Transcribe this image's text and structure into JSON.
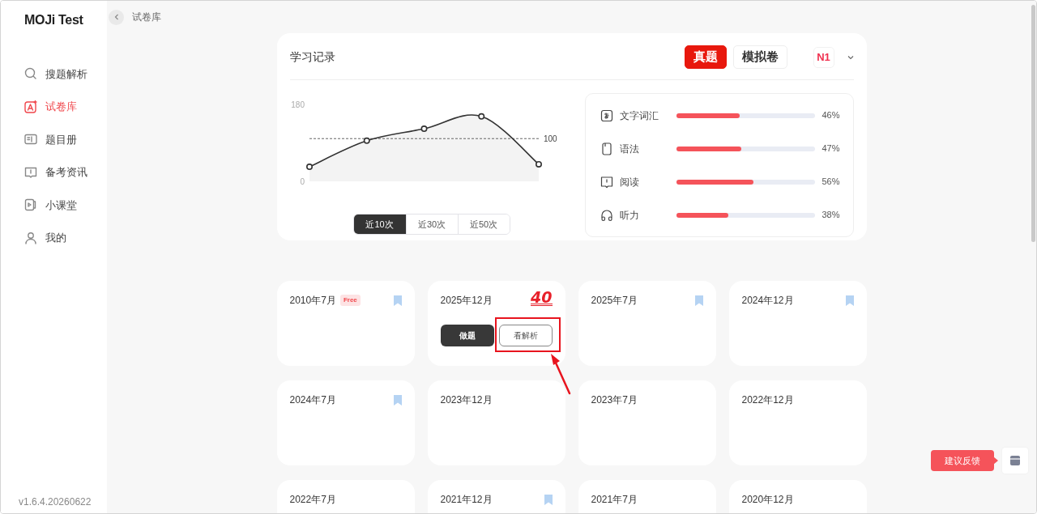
{
  "app": {
    "logo": "MOJi Test",
    "version": "v1.6.4.20260622"
  },
  "breadcrumb": "试卷库",
  "sidebar": {
    "items": [
      {
        "label": "搜题解析",
        "kind": "search",
        "selected": false
      },
      {
        "label": "试卷库",
        "kind": "paper",
        "selected": true
      },
      {
        "label": "题目册",
        "kind": "notebook",
        "selected": false
      },
      {
        "label": "备考资讯",
        "kind": "book",
        "selected": false
      },
      {
        "label": "小课堂",
        "kind": "video",
        "selected": false
      },
      {
        "label": "我的",
        "kind": "user",
        "selected": false
      }
    ]
  },
  "record": {
    "title": "学习记录",
    "tabs": [
      {
        "label": "真题",
        "selected": true
      },
      {
        "label": "模拟卷",
        "selected": false
      }
    ],
    "level": "N1",
    "chart_data": {
      "type": "area",
      "ylim": [
        0,
        180
      ],
      "yticks": [
        0,
        180
      ],
      "series": [
        {
          "color": "#333333",
          "marker": "o",
          "values": [
            34,
            95,
            123,
            152,
            40
          ]
        }
      ],
      "ref_lines": [
        {
          "axis": "y",
          "value": 100,
          "label": "100"
        }
      ]
    },
    "ranges": [
      {
        "label": "近10次",
        "selected": true
      },
      {
        "label": "近30次",
        "selected": false
      },
      {
        "label": "近50次",
        "selected": false
      }
    ],
    "skills": [
      {
        "label": "文字词汇",
        "kind": "kana",
        "level": 0.46,
        "reading": "46%"
      },
      {
        "label": "语法",
        "kind": "card",
        "level": 0.47,
        "reading": "47%"
      },
      {
        "label": "阅读",
        "kind": "book",
        "level": 0.56,
        "reading": "56%"
      },
      {
        "label": "听力",
        "kind": "headphones",
        "level": 0.38,
        "reading": "38%"
      }
    ]
  },
  "papers": [
    {
      "date": "2010年7月",
      "badge": "Free",
      "bookmark": true
    },
    {
      "date": "2025年12月",
      "score": "40",
      "bookmark": false,
      "actions": [
        {
          "label": "做题",
          "kind": "primary",
          "highlighted": false
        },
        {
          "label": "看解析",
          "kind": "outline",
          "highlighted": true
        }
      ]
    },
    {
      "date": "2025年7月",
      "bookmark": true
    },
    {
      "date": "2024年12月",
      "bookmark": true
    },
    {
      "date": "2024年7月",
      "bookmark": true
    },
    {
      "date": "2023年12月",
      "bookmark": false
    },
    {
      "date": "2023年7月",
      "bookmark": false
    },
    {
      "date": "2022年12月",
      "bookmark": false
    },
    {
      "date": "2022年7月",
      "bookmark": false
    },
    {
      "date": "2021年12月",
      "bookmark": true
    },
    {
      "date": "2021年7月",
      "bookmark": false
    },
    {
      "date": "2020年12月",
      "bookmark": false
    }
  ],
  "feedback": {
    "label": "建议反馈"
  }
}
